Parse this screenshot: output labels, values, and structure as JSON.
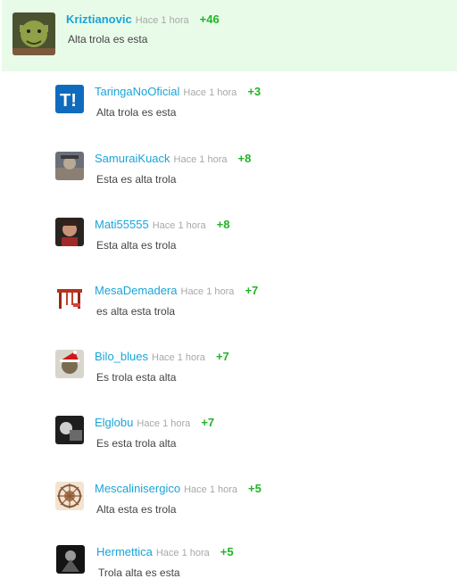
{
  "comments": [
    {
      "user": "Kriztianovic",
      "time": "Hace 1 hora",
      "score": "+46",
      "text": "Alta trola es esta",
      "avatar": "shrek-avatar"
    },
    {
      "user": "TaringaNoOficial",
      "time": "Hace 1 hora",
      "score": "+3",
      "text": "Alta trola es esta",
      "avatar": "taringa-logo-avatar"
    },
    {
      "user": "SamuraiKuack",
      "time": "Hace 1 hora",
      "score": "+8",
      "text": "Esta es alta trola",
      "avatar": "photo-avatar"
    },
    {
      "user": "Mati55555",
      "time": "Hace 1 hora",
      "score": "+8",
      "text": "Esta alta es trola",
      "avatar": "photo-avatar"
    },
    {
      "user": "MesaDemadera",
      "time": "Hace 1 hora",
      "score": "+7",
      "text": "es alta esta trola",
      "avatar": "table-avatar"
    },
    {
      "user": "Bilo_blues",
      "time": "Hace 1 hora",
      "score": "+7",
      "text": "Es trola esta alta",
      "avatar": "santa-hat-avatar"
    },
    {
      "user": "Elglobu",
      "time": "Hace 1 hora",
      "score": "+7",
      "text": "Es esta trola alta",
      "avatar": "photo-avatar"
    },
    {
      "user": "Mescalinisergico",
      "time": "Hace 1 hora",
      "score": "+5",
      "text": "Alta esta es trola",
      "avatar": "emblem-avatar"
    },
    {
      "user": "Hermettica",
      "time": "Hace 1 hora",
      "score": "+5",
      "text": "Trola alta es esta",
      "avatar": "photo-avatar"
    }
  ]
}
